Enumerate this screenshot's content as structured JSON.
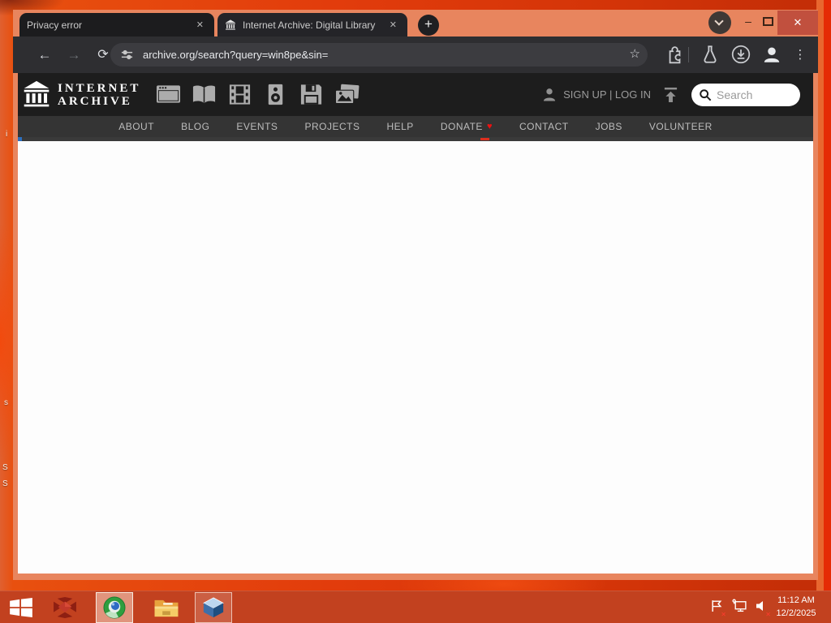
{
  "colors": {
    "desktop_orange": "#E23C0C",
    "frame_salmon": "#E8855E",
    "toolbar_dark": "#2E2E31",
    "ia_header_black": "#1D1D1D",
    "ia_nav_gray": "#343434",
    "close_button_red": "#C1503E",
    "taskbar_red": "#C2411F",
    "heart_red": "#EE1111"
  },
  "browser": {
    "tabs": [
      {
        "title": "Privacy error",
        "close_label": "✕"
      },
      {
        "title": "Internet Archive: Digital Library",
        "favicon": "internet-archive-building-icon",
        "close_label": "✕"
      }
    ],
    "new_tab_label": "+",
    "window_controls": {
      "tab_search": "chevron-down-icon",
      "minimize_label": "–",
      "maximize": "maximize-icon",
      "close_label": "✕"
    },
    "toolbar": {
      "back_label": "←",
      "forward_label": "→",
      "reload_label": "⟳",
      "site_info": "tune-icon",
      "url": "archive.org/search?query=win8pe&sin=",
      "bookmark_label": "☆",
      "icons": [
        "extensions-puzzle-icon",
        "labs-flask-icon",
        "downloads-icon",
        "profile-avatar-icon"
      ],
      "menu_label": "⋮"
    }
  },
  "page": {
    "header": {
      "brand_line1": "INTERNET",
      "brand_line2": "ARCHIVE",
      "media_icons": [
        "web-icon",
        "texts-icon",
        "video-icon",
        "audio-icon",
        "software-icon",
        "images-icon"
      ],
      "auth_label": "SIGN UP | LOG IN",
      "upload": "upload-icon",
      "search_placeholder": "Search"
    },
    "nav": {
      "items": [
        {
          "label": "ABOUT"
        },
        {
          "label": "BLOG"
        },
        {
          "label": "EVENTS"
        },
        {
          "label": "PROJECTS"
        },
        {
          "label": "HELP"
        },
        {
          "label": "DONATE",
          "heart": "♥"
        },
        {
          "label": "CONTACT"
        },
        {
          "label": "JOBS"
        },
        {
          "label": "VOLUNTEER"
        }
      ]
    },
    "content": {
      "state": ""
    }
  },
  "desktop": {
    "fragments": [
      "i",
      "s",
      "S",
      "S"
    ],
    "taskbar": {
      "icons": [
        "start-windows-icon",
        "red-app-icon",
        "chrome-icon",
        "file-explorer-icon",
        "virtualbox-icon"
      ],
      "tray_icons": [
        "action-center-flag-icon",
        "network-display-icon",
        "volume-muted-icon"
      ],
      "error_badge": "✕",
      "clock_time": "11:12 AM",
      "clock_date": "12/2/2025"
    }
  }
}
